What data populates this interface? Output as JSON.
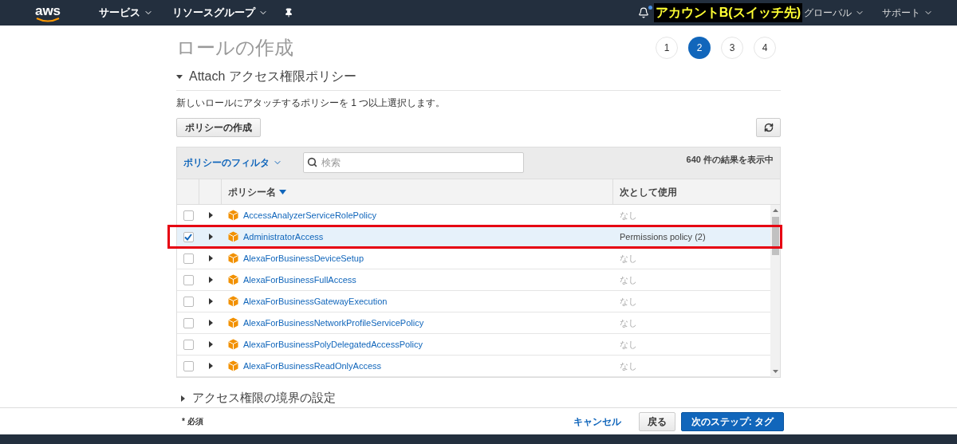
{
  "nav": {
    "logo": "aws",
    "menus": [
      {
        "label": "サービス"
      },
      {
        "label": "リソースグループ"
      }
    ],
    "account": "アカウントB(スイッチ先)",
    "notification_dot": true,
    "region": "グローバル",
    "support": "サポート"
  },
  "page": {
    "title": "ロールの作成",
    "steps": [
      {
        "label": "1",
        "selected": false
      },
      {
        "label": "2",
        "selected": true
      },
      {
        "label": "3",
        "selected": false
      },
      {
        "label": "4",
        "selected": false
      }
    ]
  },
  "section": {
    "title": "Attach アクセス権限ポリシー",
    "expanded": true,
    "description": "新しいロールにアタッチするポリシーを 1 つ以上選択します。",
    "create_button": "ポリシーの作成"
  },
  "table": {
    "filter": "ポリシーのフィルタ",
    "search": {
      "placeholder": "検索"
    },
    "result_count": "640 件の結果を表示中",
    "columns": [
      {
        "label": "ポリシー名",
        "sorted": true
      },
      {
        "label": "次として使用",
        "sorted": false
      }
    ],
    "rows": [
      {
        "name": "AccessAnalyzerServiceRolePolicy",
        "used_as": "なし",
        "checked": false,
        "highlighted": false
      },
      {
        "name": "AdministratorAccess",
        "used_as": "Permissions policy (2)",
        "checked": true,
        "highlighted": true
      },
      {
        "name": "AlexaForBusinessDeviceSetup",
        "used_as": "なし",
        "checked": false,
        "highlighted": false
      },
      {
        "name": "AlexaForBusinessFullAccess",
        "used_as": "なし",
        "checked": false,
        "highlighted": false
      },
      {
        "name": "AlexaForBusinessGatewayExecution",
        "used_as": "なし",
        "checked": false,
        "highlighted": false
      },
      {
        "name": "AlexaForBusinessNetworkProfileServicePolicy",
        "used_as": "なし",
        "checked": false,
        "highlighted": false
      },
      {
        "name": "AlexaForBusinessPolyDelegatedAccessPolicy",
        "used_as": "なし",
        "checked": false,
        "highlighted": false
      },
      {
        "name": "AlexaForBusinessReadOnlyAccess",
        "used_as": "なし",
        "checked": false,
        "highlighted": false
      }
    ]
  },
  "next_section": {
    "title": "アクセス権限の境界の設定",
    "expanded": false
  },
  "footer": {
    "required_note": "* 必須",
    "cancel": "キャンセル",
    "back": "戻る",
    "next": "次のステップ: タグ"
  }
}
